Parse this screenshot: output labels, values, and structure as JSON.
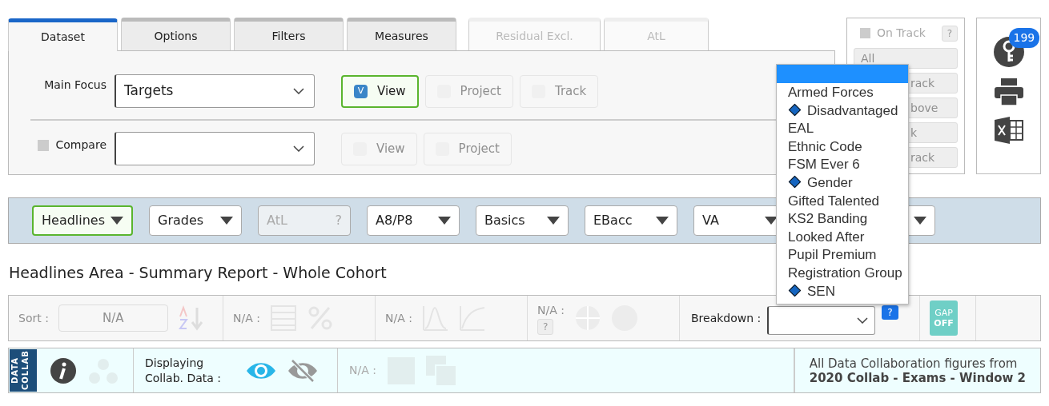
{
  "tabs": [
    {
      "label": "Dataset",
      "selected": true,
      "disabled": false
    },
    {
      "label": "Options",
      "selected": false,
      "disabled": false
    },
    {
      "label": "Filters",
      "selected": false,
      "disabled": false
    },
    {
      "label": "Measures",
      "selected": false,
      "disabled": false
    },
    {
      "label": "Residual Excl.",
      "selected": false,
      "disabled": true
    },
    {
      "label": "AtL",
      "selected": false,
      "disabled": true
    }
  ],
  "main_focus": {
    "label": "Main Focus",
    "value": "Targets",
    "buttons": [
      {
        "label": "View",
        "checked": true,
        "check_text": "V",
        "disabled": false
      },
      {
        "label": "Project",
        "checked": false,
        "disabled": true
      },
      {
        "label": "Track",
        "checked": false,
        "disabled": true
      }
    ]
  },
  "compare": {
    "label": "Compare",
    "checked": false,
    "buttons": [
      {
        "label": "View",
        "checked": false,
        "disabled": true
      },
      {
        "label": "Project",
        "checked": false,
        "disabled": true
      }
    ]
  },
  "on_track": {
    "label": "On Track",
    "checked": false,
    "help": "?",
    "disabled": true,
    "buttons": [
      {
        "label": "All"
      },
      {
        "label": "rack"
      },
      {
        "label": "bove"
      },
      {
        "label": "k"
      },
      {
        "label": "rack"
      }
    ]
  },
  "badge_count": "199",
  "toolbar": [
    {
      "kind": "dropdown",
      "label": "Headlines",
      "selected": true,
      "disabled": false
    },
    {
      "kind": "dropdown",
      "label": "Grades",
      "selected": false,
      "disabled": false
    },
    {
      "kind": "help",
      "label": "AtL",
      "help": "?",
      "selected": false,
      "disabled": true
    },
    {
      "kind": "dropdown",
      "label": "A8/P8",
      "selected": false,
      "disabled": false
    },
    {
      "kind": "dropdown",
      "label": "Basics",
      "selected": false,
      "disabled": false
    },
    {
      "kind": "dropdown",
      "label": "EBacc",
      "selected": false,
      "disabled": false
    },
    {
      "kind": "dropdown",
      "label": "VA",
      "selected": false,
      "disabled": false
    },
    {
      "kind": "dropdown",
      "selected": false,
      "disabled": false
    }
  ],
  "heading": "Headlines Area - Summary Report - Whole Cohort",
  "sort_bar": {
    "sort_label": "Sort :",
    "sort_value": "N/A",
    "groups": [
      {
        "label": "N/A :"
      },
      {
        "label": "N/A :"
      },
      {
        "label": "N/A :",
        "help": "?"
      }
    ],
    "breakdown_label": "Breakdown :",
    "breakdown_help": "?",
    "gap_line1": "GAP",
    "gap_line2": "OFF"
  },
  "collab": {
    "badge": "DATA COLLAB",
    "caption": "Displaying Collab. Data :",
    "na_label": "N/A :",
    "source_intro": "All Data Collaboration figures from",
    "source_name": "2020 Collab - Exams - Window 2"
  },
  "dropdown": {
    "items": [
      {
        "selected": true
      },
      {
        "label": "Armed Forces",
        "selected": false,
        "marked": false
      },
      {
        "label": "Disadvantaged",
        "selected": false,
        "marked": true
      },
      {
        "label": "EAL",
        "selected": false,
        "marked": false
      },
      {
        "label": "Ethnic Code",
        "selected": false,
        "marked": false
      },
      {
        "label": "FSM Ever 6",
        "selected": false,
        "marked": false
      },
      {
        "label": "Gender",
        "selected": false,
        "marked": true
      },
      {
        "label": "Gifted Talented",
        "selected": false,
        "marked": false
      },
      {
        "label": "KS2 Banding",
        "selected": false,
        "marked": false
      },
      {
        "label": "Looked After",
        "selected": false,
        "marked": false
      },
      {
        "label": "Pupil Premium",
        "selected": false,
        "marked": false
      },
      {
        "label": "Registration Group",
        "selected": false,
        "marked": false
      },
      {
        "label": "SEN",
        "selected": false,
        "marked": true
      }
    ]
  }
}
